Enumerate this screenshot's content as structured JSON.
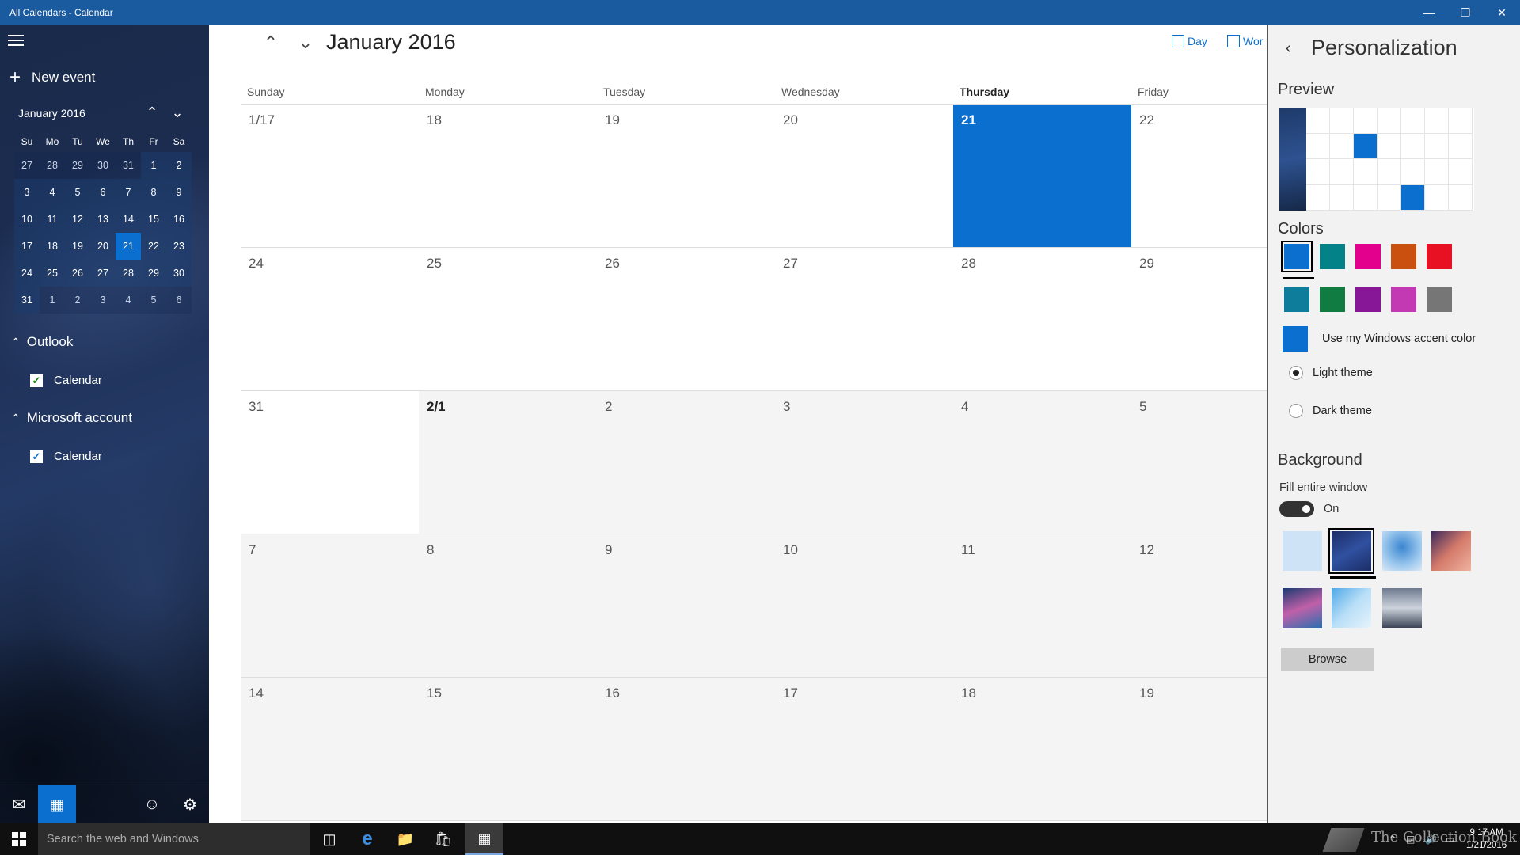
{
  "window": {
    "title": "All Calendars - Calendar"
  },
  "sidebar": {
    "new_event_label": "New event",
    "mini_cal": {
      "title": "January 2016",
      "dow": [
        "Su",
        "Mo",
        "Tu",
        "We",
        "Th",
        "Fr",
        "Sa"
      ],
      "days": [
        [
          "27",
          "28",
          "29",
          "30",
          "31",
          "1",
          "2"
        ],
        [
          "3",
          "4",
          "5",
          "6",
          "7",
          "8",
          "9"
        ],
        [
          "10",
          "11",
          "12",
          "13",
          "14",
          "15",
          "16"
        ],
        [
          "17",
          "18",
          "19",
          "20",
          "21",
          "22",
          "23"
        ],
        [
          "24",
          "25",
          "26",
          "27",
          "28",
          "29",
          "30"
        ],
        [
          "31",
          "1",
          "2",
          "3",
          "4",
          "5",
          "6"
        ]
      ],
      "today": "21"
    },
    "groups": [
      {
        "label": "Outlook",
        "calendar": "Calendar"
      },
      {
        "label": "Microsoft account",
        "calendar": "Calendar"
      }
    ]
  },
  "main": {
    "title": "January 2016",
    "views": {
      "day": "Day",
      "work_week": "Wor"
    },
    "days_of_week": [
      "Sunday",
      "Monday",
      "Tuesday",
      "Wednesday",
      "Thursday",
      "Friday"
    ],
    "weeks": [
      [
        "1/17",
        "18",
        "19",
        "20",
        "21",
        "22"
      ],
      [
        "24",
        "25",
        "26",
        "27",
        "28",
        "29"
      ],
      [
        "31",
        "2/1",
        "2",
        "3",
        "4",
        "5"
      ],
      [
        "7",
        "8",
        "9",
        "10",
        "11",
        "12"
      ],
      [
        "14",
        "15",
        "16",
        "17",
        "18",
        "19"
      ]
    ]
  },
  "panel": {
    "title": "Personalization",
    "preview_label": "Preview",
    "colors_label": "Colors",
    "colors": [
      "#0b6fd0",
      "#038387",
      "#e3008c",
      "#ca5010",
      "#e81123",
      "#0e7c9b",
      "#107c41",
      "#881798",
      "#c239b3",
      "#767676"
    ],
    "accent_label": "Use my Windows accent color",
    "light_theme": "Light theme",
    "dark_theme": "Dark theme",
    "background_label": "Background",
    "fill_label": "Fill entire window",
    "toggle_label": "On",
    "browse_label": "Browse"
  },
  "taskbar": {
    "search_placeholder": "Search the web and Windows",
    "time": "9:17 AM",
    "date": "1/21/2016",
    "watermark": "The Collection Book"
  }
}
